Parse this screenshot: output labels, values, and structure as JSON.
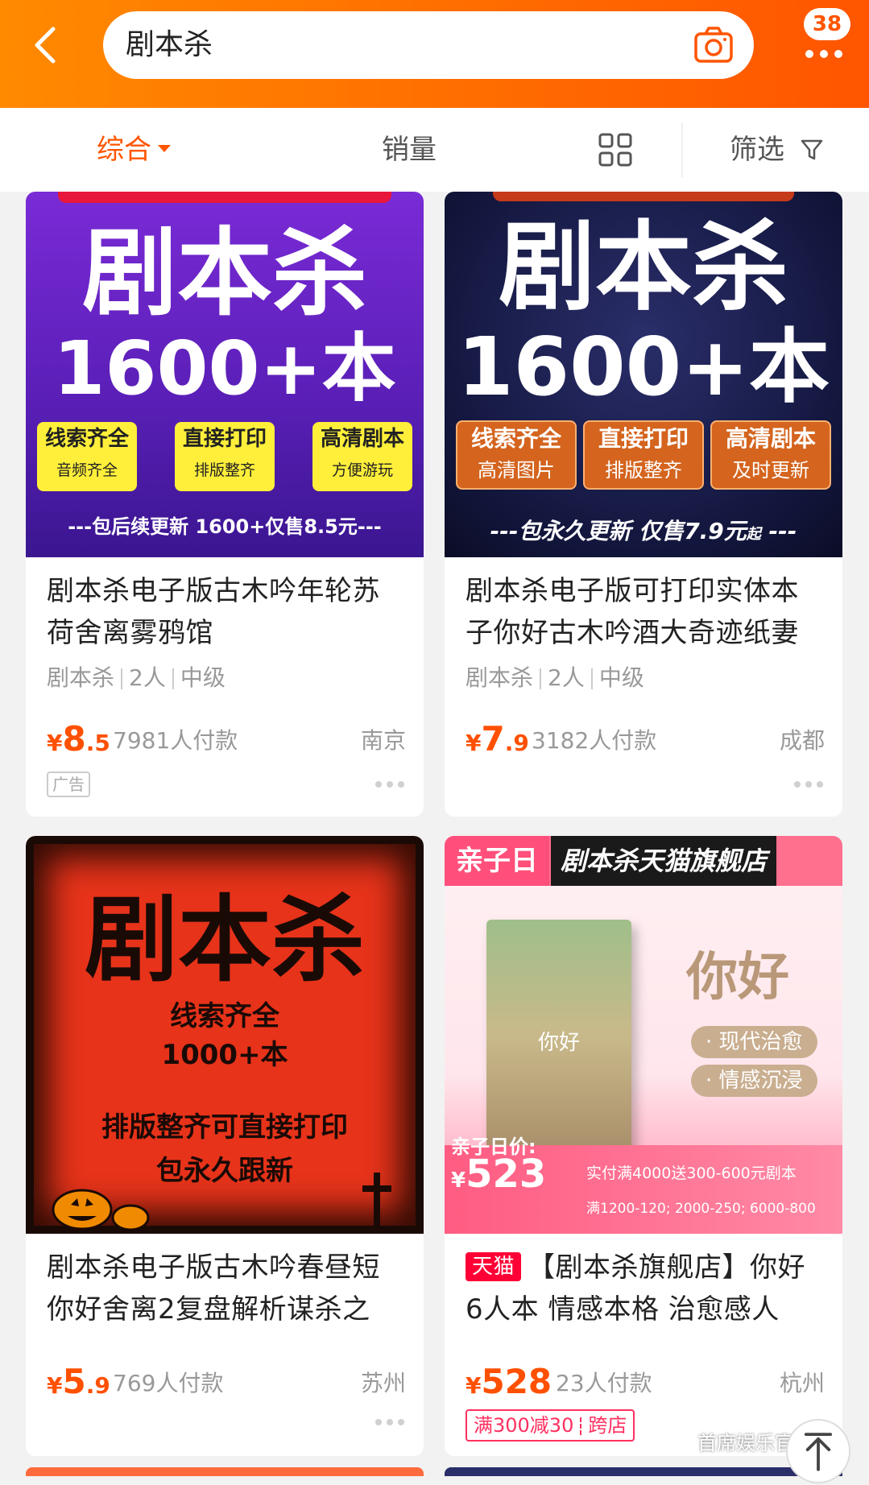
{
  "header": {
    "search_query": "剧本杀",
    "badge_count": "38",
    "colors": {
      "accent": "#ff5500",
      "bar": "#ff7a00"
    }
  },
  "sortbar": {
    "tabs": [
      {
        "label": "综合",
        "active": true
      },
      {
        "label": "销量",
        "active": false
      }
    ],
    "filter_label": "筛选"
  },
  "products": [
    {
      "image": {
        "headline": "剧本杀",
        "subline": "1600+本",
        "boxes": [
          {
            "a": "线索齐全",
            "b": "音频齐全"
          },
          {
            "a": "直接打印",
            "b": "排版整齐"
          },
          {
            "a": "高清剧本",
            "b": "方便游玩"
          }
        ],
        "bottom": "---包后续更新 1600+仅售8.5元---"
      },
      "title": "剧本杀电子版古木吟年轮苏荷舍离雾鸦馆",
      "tags": [
        "剧本杀",
        "2人",
        "中级"
      ],
      "price_symbol": "¥",
      "price_int": "8",
      "price_dec": ".5",
      "sales": "7981人付款",
      "city": "南京",
      "ad_label": "广告"
    },
    {
      "image": {
        "headline": "剧本杀",
        "subline": "1600+本",
        "boxes": [
          {
            "a": "线索齐全",
            "b": "高清图片"
          },
          {
            "a": "直接打印",
            "b": "排版整齐"
          },
          {
            "a": "高清剧本",
            "b": "及时更新"
          }
        ],
        "bottom": "---包永久更新 仅售7.9元",
        "bottom_suffix": "起",
        "bottom_tail": " ---"
      },
      "title": "剧本杀电子版可打印实体本子你好古木吟酒大奇迹纸妻",
      "tags": [
        "剧本杀",
        "2人",
        "中级"
      ],
      "price_symbol": "¥",
      "price_int": "7",
      "price_dec": ".9",
      "sales": "3182人付款",
      "city": "成都"
    },
    {
      "image": {
        "headline": "剧本杀",
        "line1": "线索齐全",
        "line2": "1000+本",
        "line3": "排版整齐可直接打印",
        "line4": "包永久跟新"
      },
      "title": "剧本杀电子版古木吟春昼短你好舍离2复盘解析谋杀之",
      "price_symbol": "¥",
      "price_int": "5",
      "price_dec": ".9",
      "sales": "769人付款",
      "city": "苏州"
    },
    {
      "image": {
        "tag": "亲子日",
        "store": "剧本杀天猫旗舰店",
        "hello": "你好",
        "book_title": "你好",
        "pill1": "· 现代治愈",
        "pill2": "· 情感沉浸",
        "day_price_label": "亲子日价:",
        "day_price_symbol": "¥",
        "day_price": "523",
        "offer1": "实付满4000送300-600元剧本",
        "offer2": "满1200-120; 2000-250; 6000-800"
      },
      "badge": "天猫",
      "title": "【剧本杀旗舰店】你好 6人本 情感本格 治愈感人",
      "price_symbol": "¥",
      "price_int": "528",
      "price_dec": "",
      "sales": "23人付款",
      "city": "杭州",
      "promo_a": "满300减30",
      "promo_b": "跨店"
    }
  ],
  "watermark": "首席娱乐官"
}
